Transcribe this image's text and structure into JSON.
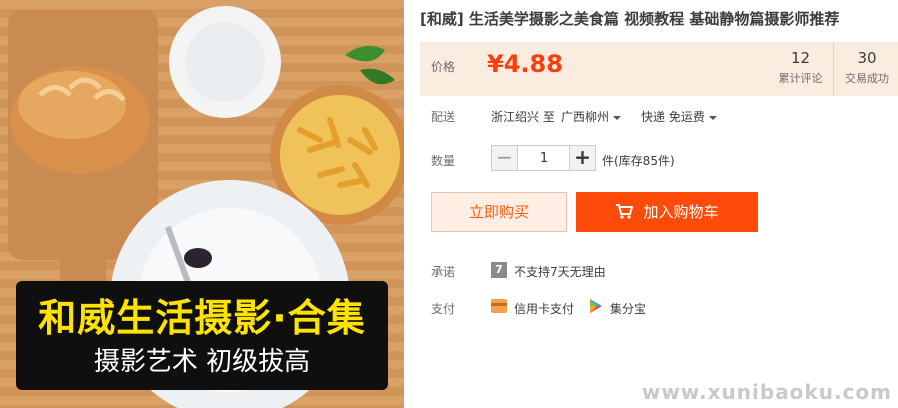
{
  "product": {
    "title": "[和威] 生活美学摄影之美食篇 视频教程 基础静物篇摄影师推荐",
    "banner_title": "和威生活摄影·合集",
    "banner_subtitle": "摄影艺术 初级拔高"
  },
  "price": {
    "label": "价格",
    "value": "¥4.88",
    "reviews_count": "12",
    "reviews_label": "累计评论",
    "deals_count": "30",
    "deals_label": "交易成功"
  },
  "shipping": {
    "label": "配送",
    "from": "浙江绍兴 至",
    "to": "广西柳州",
    "method": "快递 免运费"
  },
  "quantity": {
    "label": "数量",
    "value": "1",
    "minus": "−",
    "plus": "+",
    "stock": "件(库存85件)"
  },
  "actions": {
    "buy_now": "立即购买",
    "add_to_cart": "加入购物车"
  },
  "promise": {
    "label": "承诺",
    "icon_text": "7",
    "text": "不支持7天无理由"
  },
  "payment": {
    "label": "支付",
    "credit_card": "信用卡支付",
    "jifenbao": "集分宝"
  },
  "watermark": "www.xunibaoku.com",
  "icons": {
    "cart": "cart-icon",
    "promise": "seven-day-icon",
    "credit_card": "credit-card-icon",
    "jifenbao": "jifenbao-icon"
  },
  "colors": {
    "accent": "#ff4b0a",
    "price": "#ff3d0c",
    "price_bg": "#fbece0",
    "buy_bg": "#ffeee3"
  }
}
